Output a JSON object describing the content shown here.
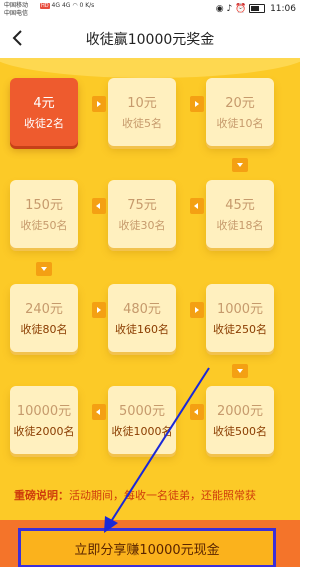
{
  "status_bar": {
    "carrier_1": "中国移动",
    "carrier_2": "中国电信",
    "net_badge": "HD",
    "signal_1": "4G",
    "signal_2": "4G",
    "speed": "0 K/s",
    "time": "11:06"
  },
  "header": {
    "title": "收徒赢10000元奖金"
  },
  "rewards": [
    {
      "amount": "4元",
      "count": "收徒2名",
      "active": true
    },
    {
      "amount": "10元",
      "count": "收徒5名",
      "active": false
    },
    {
      "amount": "20元",
      "count": "收徒10名",
      "active": false
    },
    {
      "amount": "45元",
      "count": "收徒18名",
      "active": false
    },
    {
      "amount": "75元",
      "count": "收徒30名",
      "active": false
    },
    {
      "amount": "150元",
      "count": "收徒50名",
      "active": false
    },
    {
      "amount": "240元",
      "count": "收徒80名",
      "active": false
    },
    {
      "amount": "480元",
      "count": "收徒160名",
      "active": false
    },
    {
      "amount": "1000元",
      "count": "收徒250名",
      "active": false
    },
    {
      "amount": "2000元",
      "count": "收徒500名",
      "active": false
    },
    {
      "amount": "5000元",
      "count": "收徒1000名",
      "active": false
    },
    {
      "amount": "10000元",
      "count": "收徒2000名",
      "active": false
    }
  ],
  "rules": {
    "label": "重磅说明：",
    "text": "活动期间，每收一名徒弟，还能照常获"
  },
  "cta": {
    "label": "立即分享赚10000元现金"
  },
  "colors": {
    "accent": "#fcca27",
    "active_card": "#ee5b2e",
    "cta_border": "#3b2fd8",
    "bottom_bar": "#f4742a"
  }
}
